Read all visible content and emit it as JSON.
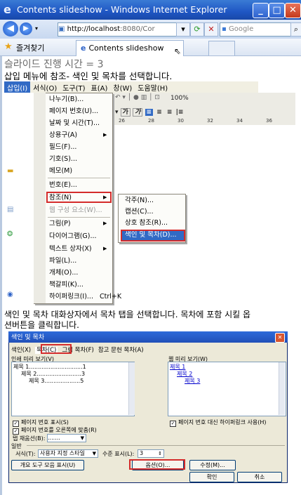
{
  "window": {
    "title": "Contents slideshow - Windows Internet Explorer",
    "address": "http://localhost:8080/Cor",
    "address_host": "http://localhost",
    "address_rest": ":8080/Cor",
    "search_placeholder": "Google",
    "favorites_label": "즐겨찾기",
    "tab_label": "Contents slideshow"
  },
  "page": {
    "heading": "슬라이드 진행 시간 = 3",
    "instruction1": "삽입 메뉴에 참조- 색인 및 목차를 선택합니다.",
    "instruction2_line1": "색인 및 목차 대화상자에서 목차 탭을 선택합니다. 목차에 포함 시킬 옵",
    "instruction2_line2": "션버튼을 클릭합니다."
  },
  "menubar": {
    "items": [
      "삽입(I)",
      "서식(O)",
      "도구(T)",
      "표(A)",
      "창(W)",
      "도움말(H)"
    ],
    "zoom": "100%"
  },
  "insert_menu": {
    "items": [
      {
        "label": "나누기(B)...",
        "disabled": false,
        "submenu": false
      },
      {
        "label": "페이지 번호(U)...",
        "disabled": false,
        "submenu": false
      },
      {
        "label": "날짜 및 시간(T)...",
        "disabled": false,
        "submenu": false
      },
      {
        "label": "상용구(A)",
        "disabled": false,
        "submenu": true
      },
      {
        "label": "필드(F)...",
        "disabled": false,
        "submenu": false
      },
      {
        "label": "기호(S)...",
        "disabled": false,
        "submenu": false
      },
      {
        "label": "메모(M)",
        "disabled": false,
        "submenu": false
      },
      {
        "label": "번호(E)...",
        "disabled": false,
        "submenu": false
      },
      {
        "label": "참조(N)",
        "disabled": false,
        "submenu": true
      },
      {
        "label": "웹 구성 요소(W)...",
        "disabled": true,
        "submenu": false
      },
      {
        "label": "그림(P)",
        "disabled": false,
        "submenu": true
      },
      {
        "label": "다이어그램(G)...",
        "disabled": false,
        "submenu": false
      },
      {
        "label": "텍스트 상자(X)",
        "disabled": false,
        "submenu": true
      },
      {
        "label": "파일(L)...",
        "disabled": false,
        "submenu": false
      },
      {
        "label": "개체(O)...",
        "disabled": false,
        "submenu": false
      },
      {
        "label": "책갈피(K)...",
        "disabled": false,
        "submenu": false
      },
      {
        "label": "하이퍼링크(I)...",
        "disabled": false,
        "submenu": false,
        "shortcut": "Ctrl+K"
      }
    ]
  },
  "reference_submenu": {
    "items": [
      "각주(N)...",
      "캡션(C)...",
      "상호 참조(R)...",
      "색인 및 목차(D)..."
    ]
  },
  "ruler_ticks": [
    "26",
    "28",
    "30",
    "32",
    "34",
    "36"
  ],
  "dialog": {
    "title": "색인 및 목차",
    "tabs": [
      "색인(X)",
      "목차(C)",
      "그림 목차(F)",
      "참고 문헌 목차(A)"
    ],
    "print_preview_label": "인쇄 미리 보기(V)",
    "web_preview_label": "웹 미리 보기(W)",
    "print_preview_lines": [
      {
        "text": "제목 1..............................",
        "page": "1"
      },
      {
        "text": "제목 2.........................",
        "page": "3"
      },
      {
        "text": "제목 3....................",
        "page": "5"
      }
    ],
    "web_preview_links": [
      "제목 1",
      "제목 2",
      "제목 3"
    ],
    "chk_show_page_numbers": "페이지 번호 표시(S)",
    "chk_right_align": "페이지 번호를 오른쪽에 맞춤(R)",
    "chk_use_hyperlinks": "페이지 번호 대신 하이퍼링크 사용(H)",
    "tab_leader_label": "탭 채움선(B):",
    "tab_leader_value": ".......",
    "general_label": "일반",
    "formats_label": "서식(T):",
    "formats_value": "사용자 지정 스타일",
    "levels_label": "수준 표시(L):",
    "levels_value": "3",
    "outline_button": "개요 도구 모음 표시(U)",
    "options_button": "옵션(O)...",
    "modify_button": "수정(M)...",
    "ok_button": "확인",
    "cancel_button": "취소"
  }
}
